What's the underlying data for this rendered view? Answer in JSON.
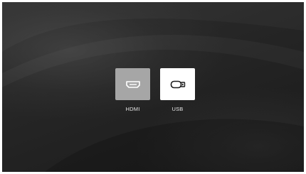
{
  "sources": [
    {
      "label": "HDMI",
      "icon": "hdmi-port-icon",
      "state": "selected"
    },
    {
      "label": "USB",
      "icon": "usb-drive-icon",
      "state": "unselected"
    }
  ],
  "colors": {
    "background": "#262626",
    "selected_tile": "#a6a6a6",
    "unselected_tile": "#ffffff",
    "label_text": "#e6e6e6"
  }
}
